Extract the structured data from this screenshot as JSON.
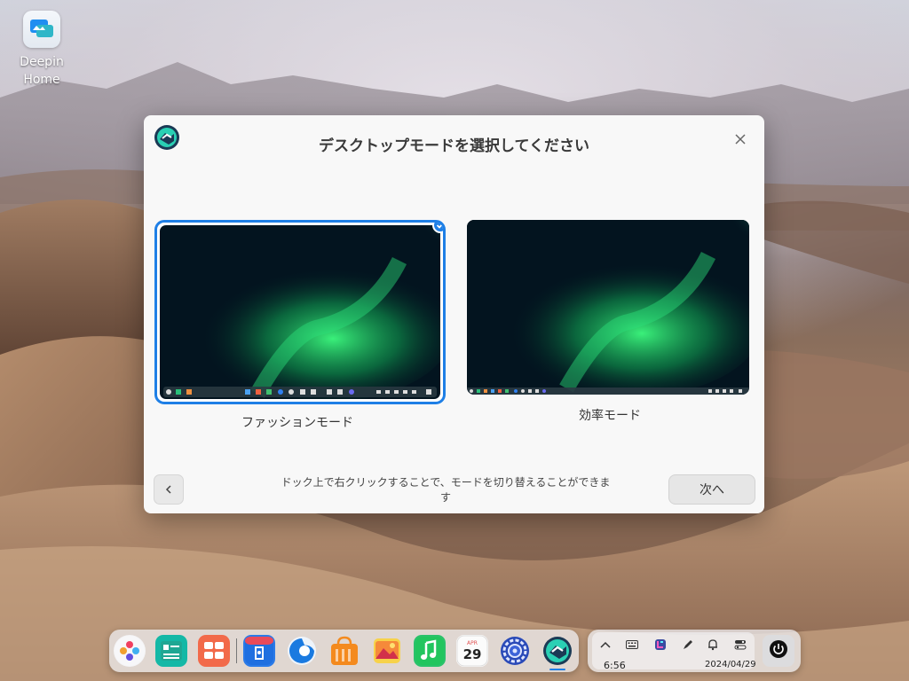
{
  "desktop": {
    "icons": [
      {
        "label": "Deepin\nHome",
        "line1": "Deepin",
        "line2": "Home",
        "icon": "deepin-home-icon"
      }
    ]
  },
  "dialog": {
    "title": "デスクトップモードを選択してください",
    "modes": [
      {
        "label": "ファッションモード",
        "selected": true
      },
      {
        "label": "効率モード",
        "selected": false
      }
    ],
    "hint": "ドック上で右クリックすることで、モードを切り替えることができます",
    "next_label": "次へ",
    "back_icon": "chevron-left-icon",
    "close_icon": "close-icon",
    "accent": "#1e7fe6"
  },
  "dock": {
    "apps": [
      "launcher-icon",
      "deepin-store-icon",
      "multitasking-icon",
      "app-store-icon",
      "browser-icon",
      "app-shop-icon",
      "photos-icon",
      "music-icon",
      "calendar-icon",
      "settings-icon",
      "deepin-home-icon"
    ],
    "calendar": {
      "month": "APR",
      "day": "29"
    }
  },
  "tray": {
    "icons": [
      "chevron-up-icon",
      "keyboard-icon",
      "color-picker-icon",
      "pen-icon",
      "bell-icon",
      "toggle-icon"
    ],
    "time": "6:56",
    "date": "2024/04/29",
    "power_icon": "power-icon"
  }
}
